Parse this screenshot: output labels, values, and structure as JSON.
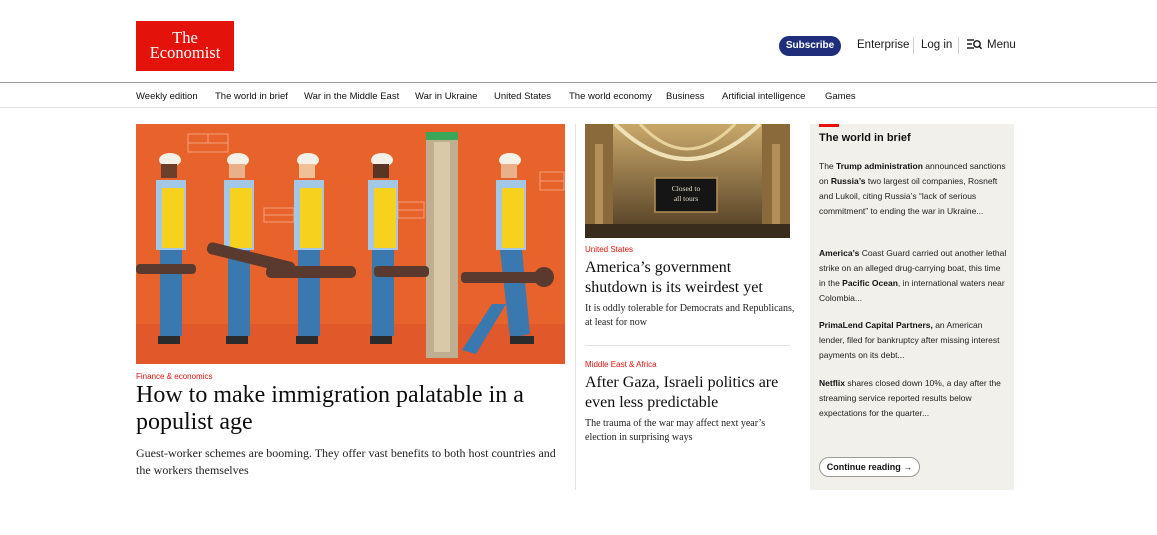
{
  "header": {
    "logo_line1": "The",
    "logo_line2": "Economist",
    "subscribe": "Subscribe",
    "enterprise": "Enterprise",
    "login": "Log in",
    "menu": "Menu"
  },
  "nav": {
    "items": [
      "Weekly edition",
      "The world in brief",
      "War in the Middle East",
      "War in Ukraine",
      "United States",
      "The world economy",
      "Business",
      "Artificial intelligence",
      "Games"
    ]
  },
  "lead": {
    "kicker": "Finance & economics",
    "title": "How to make immigration palatable in a populist age",
    "description": "Guest-worker schemes are booming. They offer vast benefits to both host countries and the workers themselves"
  },
  "secondary": [
    {
      "sign_line1": "Closed to",
      "sign_line2": "all tours",
      "kicker": "United States",
      "title": "America’s government shutdown is its weirdest yet",
      "description": "It is oddly tolerable for Democrats and Republicans, at least for now"
    },
    {
      "kicker": "Middle East & Africa",
      "title": "After Gaza, Israeli politics are even less predictable",
      "description": "The trauma of the war may affect next year’s election in surprising ways"
    }
  ],
  "brief": {
    "title": "The world in brief",
    "items": [
      [
        {
          "t": "The ",
          "b": false
        },
        {
          "t": "Trump administration",
          "b": true
        },
        {
          "t": " announced sanctions on ",
          "b": false
        },
        {
          "t": "Russia’s",
          "b": true
        },
        {
          "t": " two largest oil companies, Rosneft and Lukoil, citing Russia’s “lack of serious commitment” to ending the war in Ukraine...",
          "b": false
        }
      ],
      [
        {
          "t": "America’s",
          "b": true
        },
        {
          "t": " Coast Guard carried out another lethal strike on an alleged drug-carrying boat, this time in the ",
          "b": false
        },
        {
          "t": "Pacific Ocean",
          "b": true
        },
        {
          "t": ", in international waters near Colombia...",
          "b": false
        }
      ],
      [
        {
          "t": "PrimaLend Capital Partners,",
          "b": true
        },
        {
          "t": " an American lender, filed for bankruptcy after missing interest payments on its debt...",
          "b": false
        }
      ],
      [
        {
          "t": "Netflix",
          "b": true
        },
        {
          "t": " shares closed down 10%, a day after the streaming service reported results below expectations for the quarter...",
          "b": false
        }
      ]
    ],
    "continue": "Continue reading →"
  },
  "colors": {
    "brand_red": "#e3120b",
    "subscribe_navy": "#1f2e7a",
    "brief_bg": "#f2f0ea",
    "illustration_orange": "#e8622c"
  }
}
